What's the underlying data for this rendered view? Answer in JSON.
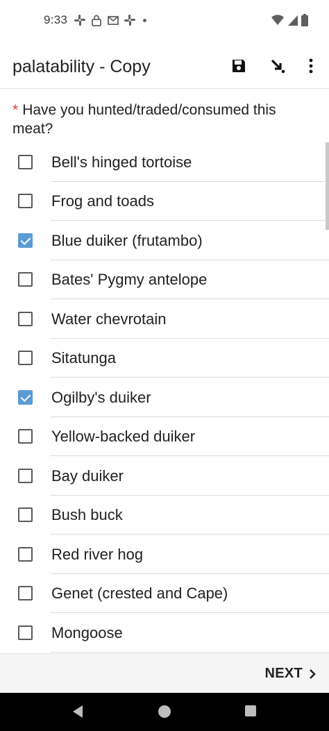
{
  "status_bar": {
    "time": "9:33",
    "left_icons": [
      "slack-icon",
      "lock-icon",
      "gmail-icon",
      "slack-icon",
      "dot-icon"
    ],
    "right_icons": [
      "wifi-icon",
      "signal-icon",
      "battery-icon"
    ]
  },
  "toolbar": {
    "title": "palatability - Copy",
    "actions": [
      "save-icon",
      "save-and-exit-icon",
      "more-options-icon"
    ]
  },
  "question": {
    "required_marker": "*",
    "text": "Have you hunted/traded/consumed this meat?"
  },
  "options": [
    {
      "label": "Bell's hinged tortoise",
      "checked": false
    },
    {
      "label": "Frog and toads",
      "checked": false
    },
    {
      "label": "Blue duiker (frutambo)",
      "checked": true
    },
    {
      "label": "Bates' Pygmy antelope",
      "checked": false
    },
    {
      "label": "Water chevrotain",
      "checked": false
    },
    {
      "label": "Sitatunga",
      "checked": false
    },
    {
      "label": "Ogilby's duiker",
      "checked": true
    },
    {
      "label": "Yellow-backed duiker",
      "checked": false
    },
    {
      "label": "Bay duiker",
      "checked": false
    },
    {
      "label": "Bush buck",
      "checked": false
    },
    {
      "label": "Red river hog",
      "checked": false
    },
    {
      "label": "Genet (crested and Cape)",
      "checked": false
    },
    {
      "label": "Mongoose",
      "checked": false
    }
  ],
  "bottom_bar": {
    "next_label": "NEXT"
  },
  "nav_bar": {
    "buttons": [
      "back-icon",
      "home-icon",
      "recents-icon"
    ]
  },
  "colors": {
    "checkbox_checked": "#5b9bd5",
    "required_marker": "#e53935"
  }
}
